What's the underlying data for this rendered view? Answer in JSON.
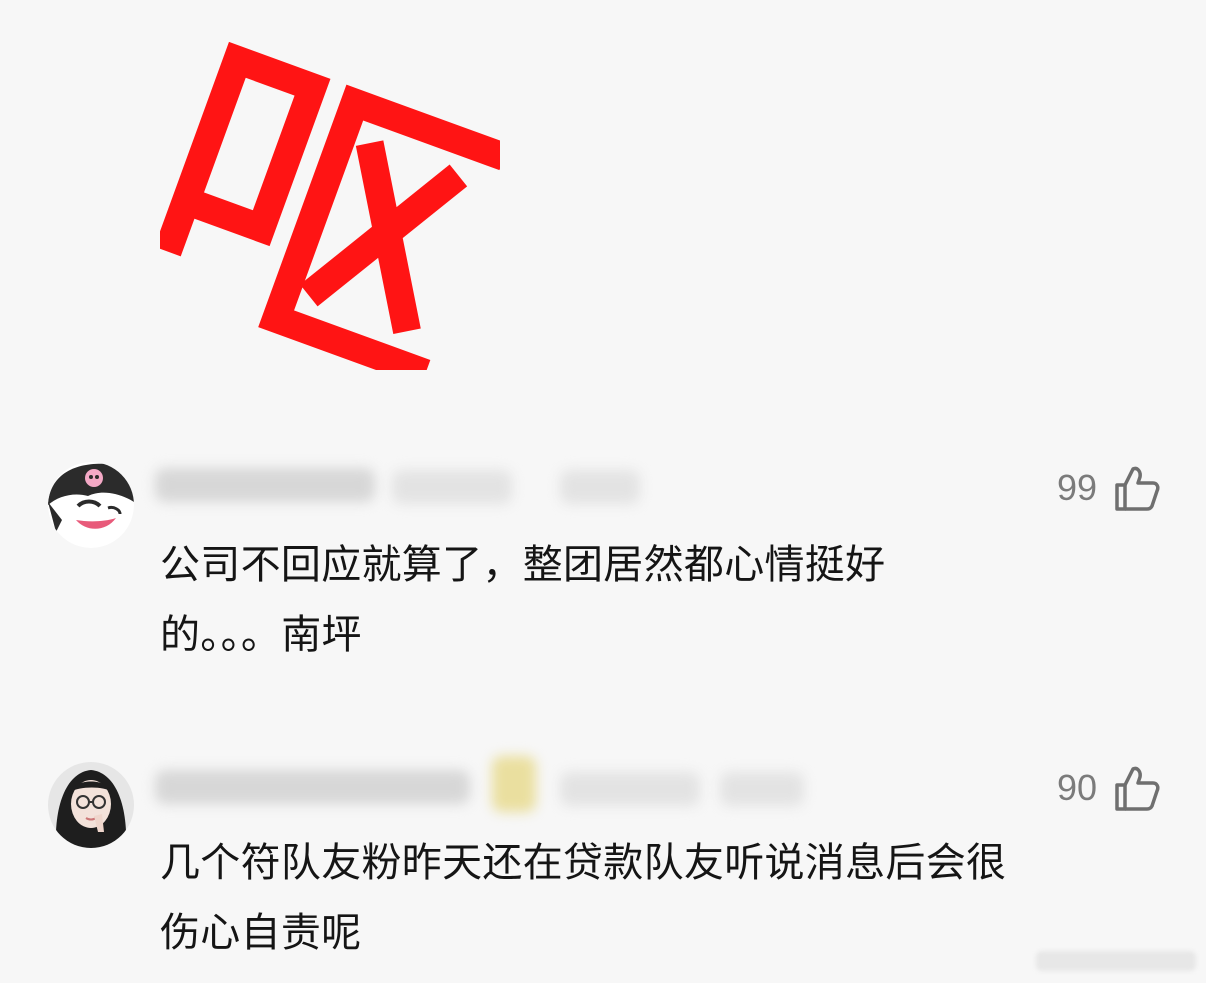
{
  "sticker": {
    "character": "呕",
    "color": "#ff1414"
  },
  "comments": [
    {
      "avatar": "cartoon-character-avatar",
      "likes": "99",
      "text": "公司不回应就算了，整团居然都心情挺好的。。。南坪",
      "lines": [
        "公司不回应就算了，整团居然都心情挺好",
        "的。。。南坪"
      ]
    },
    {
      "avatar": "girl-photo-avatar",
      "likes": "90",
      "text": "几个符队友粉昨天还在贷款队友听说消息后会很伤心自责呢",
      "lines": [
        "几个符队友粉昨天还在贷款队友听说消息后会很",
        "伤心自责呢"
      ]
    }
  ],
  "icons": {
    "like": "thumbs-up-icon"
  }
}
